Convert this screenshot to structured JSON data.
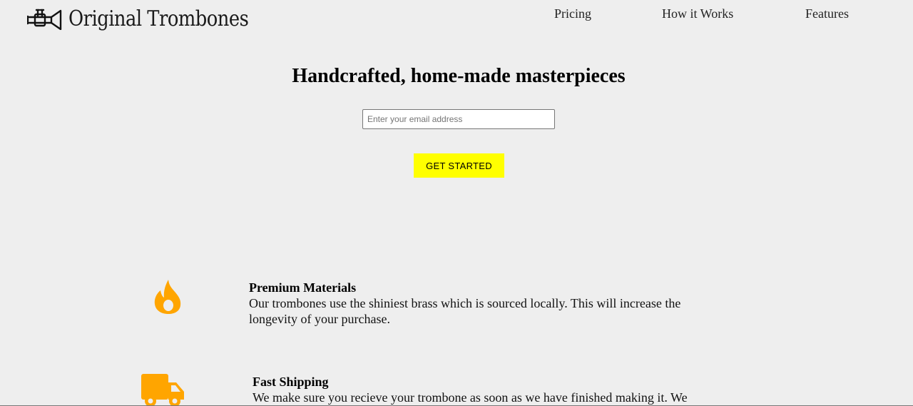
{
  "brand": {
    "name": "Original Trombones",
    "logo_icon": "trombone-icon"
  },
  "nav": {
    "items": [
      {
        "label": "Pricing"
      },
      {
        "label": "How it Works"
      },
      {
        "label": "Features"
      }
    ]
  },
  "hero": {
    "title": "Handcrafted, home-made masterpieces",
    "email_placeholder": "Enter your email address",
    "email_value": "",
    "cta_label": "GET STARTED"
  },
  "features": [
    {
      "icon": "fire-icon",
      "title": "Premium Materials",
      "description": "Our trombones use the shiniest brass which is sourced locally. This will increase the longevity of your purchase."
    },
    {
      "icon": "truck-icon",
      "title": "Fast Shipping",
      "description": "We make sure you recieve your trombone as soon as we have finished making it. We"
    }
  ],
  "colors": {
    "background": "#eeeeee",
    "cta": "#ffff00",
    "icon_accent": "#ffa500"
  }
}
